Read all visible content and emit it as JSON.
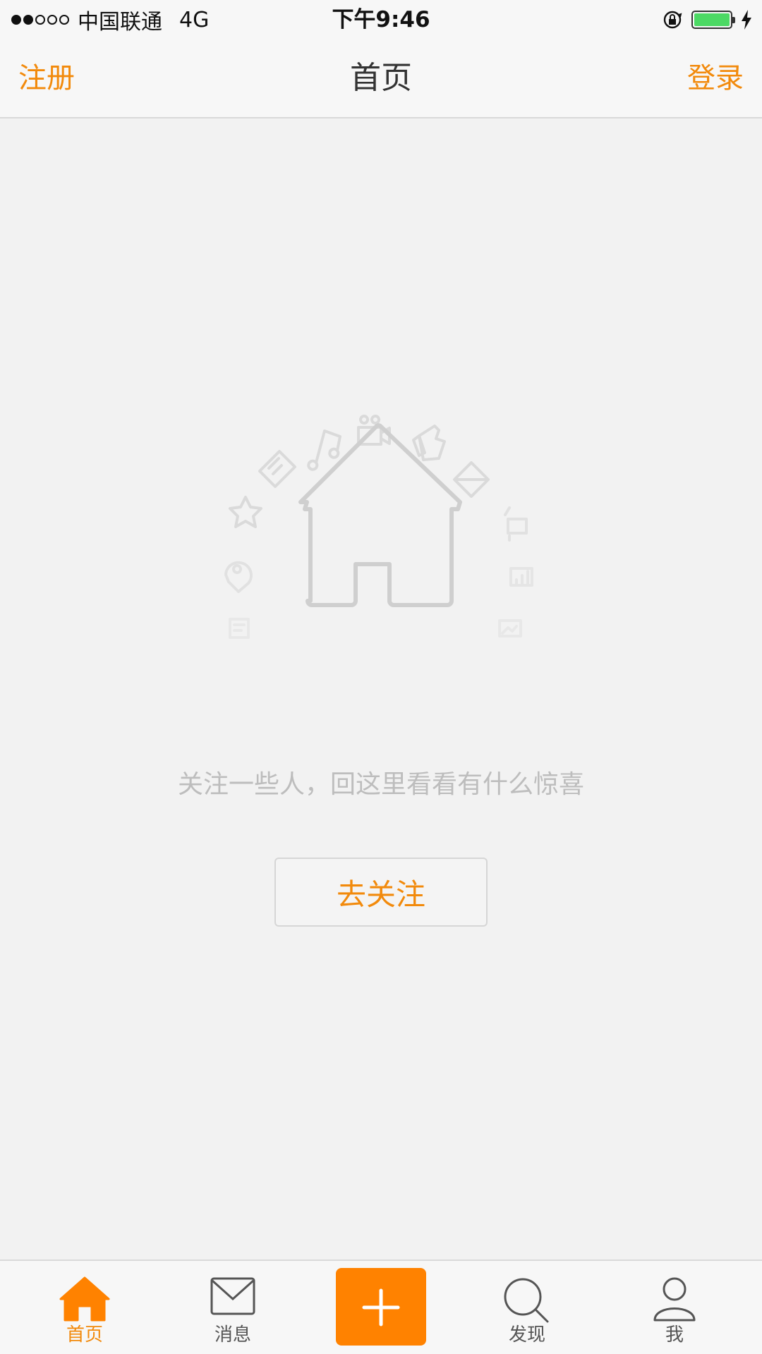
{
  "status_bar": {
    "signal_dots_filled": 2,
    "signal_dots_total": 5,
    "carrier": "中国联通",
    "network": "4G",
    "time": "下午9:46",
    "battery_level": 1.0,
    "icons": [
      "rotation-lock-icon",
      "battery-icon",
      "charging-bolt-icon"
    ]
  },
  "navbar": {
    "left_label": "注册",
    "title": "首页",
    "right_label": "登录"
  },
  "empty_state": {
    "illustration": "house-icon",
    "message": "关注一些人，回这里看看有什么惊喜",
    "button_label": "去关注"
  },
  "tabbar": {
    "tabs": [
      {
        "label": "首页",
        "icon": "home-icon",
        "active": true
      },
      {
        "label": "消息",
        "icon": "mail-icon",
        "active": false
      },
      {
        "label": "",
        "icon": "plus-icon",
        "active": false
      },
      {
        "label": "发现",
        "icon": "search-icon",
        "active": false
      },
      {
        "label": "我",
        "icon": "profile-icon",
        "active": false
      }
    ]
  },
  "colors": {
    "accent": "#f28a0c",
    "compose_button": "#ff8200",
    "background": "#f2f2f2",
    "battery": "#4cd964"
  }
}
